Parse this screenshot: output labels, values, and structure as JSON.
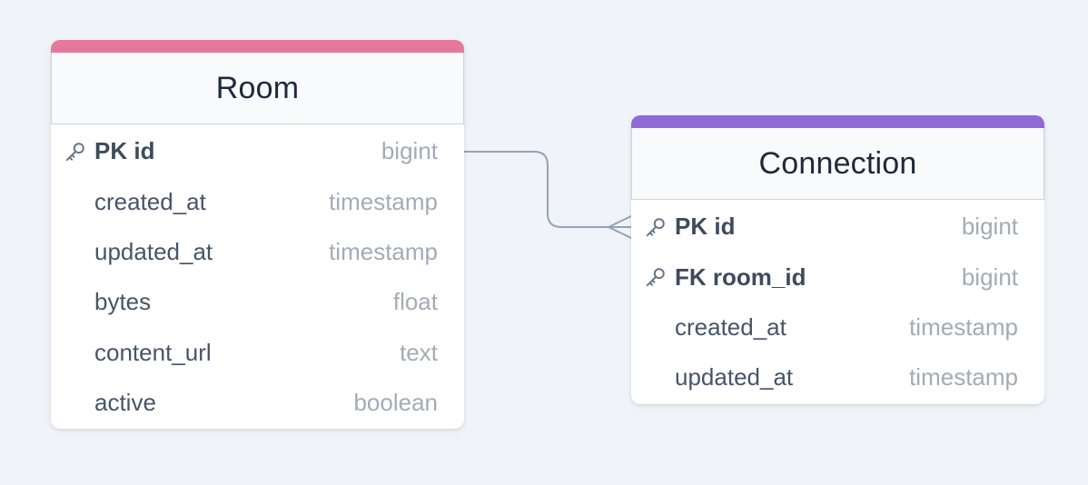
{
  "colors": {
    "background": "#f0f4f8",
    "room_accent": "#e5799b",
    "connection_accent": "#9168d8",
    "connector_line": "#94a3b8"
  },
  "relationship": {
    "from": "Room.id",
    "to": "Connection.room_id",
    "cardinality": "one-to-many"
  },
  "tables": {
    "room": {
      "title": "Room",
      "columns": [
        {
          "key": "PK",
          "name": "id",
          "type": "bigint"
        },
        {
          "key": "",
          "name": "created_at",
          "type": "timestamp"
        },
        {
          "key": "",
          "name": "updated_at",
          "type": "timestamp"
        },
        {
          "key": "",
          "name": "bytes",
          "type": "float"
        },
        {
          "key": "",
          "name": "content_url",
          "type": "text"
        },
        {
          "key": "",
          "name": "active",
          "type": "boolean"
        }
      ]
    },
    "connection": {
      "title": "Connection",
      "columns": [
        {
          "key": "PK",
          "name": "id",
          "type": "bigint"
        },
        {
          "key": "FK",
          "name": "room_id",
          "type": "bigint"
        },
        {
          "key": "",
          "name": "created_at",
          "type": "timestamp"
        },
        {
          "key": "",
          "name": "updated_at",
          "type": "timestamp"
        }
      ]
    }
  }
}
